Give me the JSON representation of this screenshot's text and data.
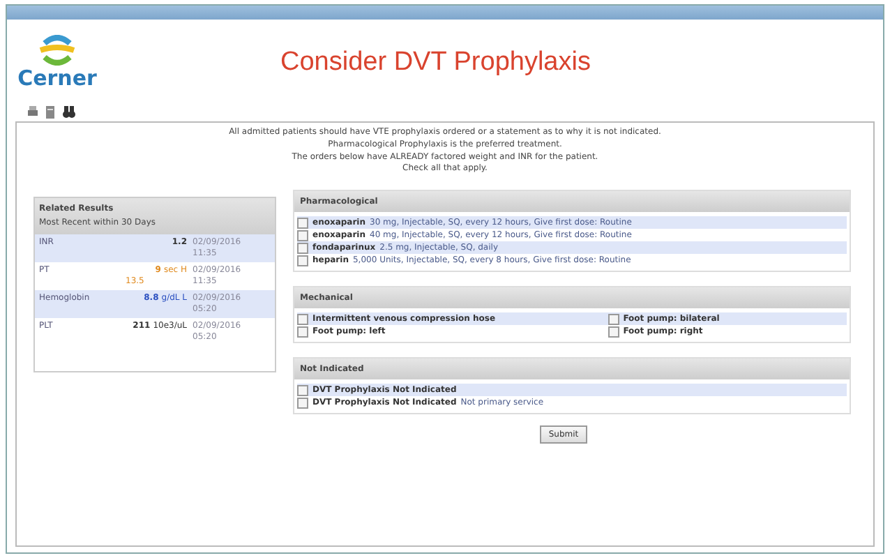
{
  "logo": {
    "text": "Cerner"
  },
  "title": "Consider DVT Prophylaxis",
  "intro": [
    "All admitted patients should have VTE prophylaxis ordered or a statement as to why it is not indicated.",
    "Pharmacological Prophylaxis is the preferred treatment.",
    "The orders below have ALREADY factored weight and INR for the patient.",
    "Check all that apply."
  ],
  "results": {
    "title": "Related Results",
    "subtitle": "Most Recent within 30 Days",
    "rows": [
      {
        "name": "INR",
        "value": "1.2",
        "color": "#333333",
        "date": "02/09/2016",
        "time": "11:35"
      },
      {
        "name": "PT",
        "value": "9",
        "unit": "sec H",
        "extra": "13.5",
        "color": "#e08a1e",
        "date": "02/09/2016",
        "time": "11:35"
      },
      {
        "name": "Hemoglobin",
        "value": "8.8",
        "unit": "g/dL L",
        "color": "#2a4fc0",
        "date": "02/09/2016",
        "time": "05:20"
      },
      {
        "name": "PLT",
        "value": "211",
        "unit": "10e3/uL",
        "color": "#333333",
        "date": "02/09/2016",
        "time": "05:20"
      }
    ]
  },
  "sections": [
    {
      "title": "Pharmacological",
      "kind": "list",
      "items": [
        {
          "name": "enoxaparin",
          "detail": "30 mg, Injectable, SQ, every 12 hours, Give first dose: Routine",
          "checked": false
        },
        {
          "name": "enoxaparin",
          "detail": "40 mg, Injectable, SQ, every 12 hours, Give first dose: Routine",
          "checked": false
        },
        {
          "name": "fondaparinux",
          "detail": "2.5 mg, Injectable, SQ, daily",
          "checked": false
        },
        {
          "name": "heparin",
          "detail": "5,000 Units, Injectable, SQ, every 8 hours, Give first dose: Routine",
          "checked": false
        }
      ]
    },
    {
      "title": "Mechanical",
      "kind": "grid",
      "items": [
        {
          "name": "Intermittent venous compression hose",
          "checked": false
        },
        {
          "name": "Foot pump: bilateral",
          "checked": false
        },
        {
          "name": "Foot pump: left",
          "checked": false
        },
        {
          "name": "Foot pump: right",
          "checked": false
        }
      ]
    },
    {
      "title": "Not Indicated",
      "kind": "list",
      "items": [
        {
          "name": "DVT Prophylaxis Not Indicated",
          "checked": false
        },
        {
          "name": "DVT Prophylaxis Not Indicated",
          "detail": "Not primary service",
          "checked": false
        }
      ]
    }
  ],
  "submit": "Submit"
}
